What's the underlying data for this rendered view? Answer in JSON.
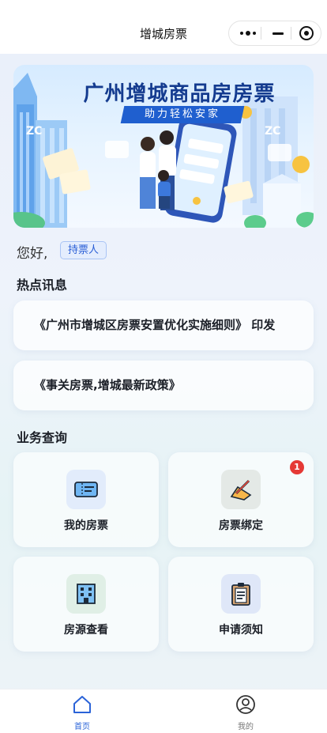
{
  "nav": {
    "title": "增城房票",
    "more_icon": "more-dots-icon",
    "minimize_icon": "minimize-icon",
    "close_icon": "target-close-icon"
  },
  "banner": {
    "title": "广州增城商品房房票",
    "subtitle": "助力轻松安家",
    "building_label": "ZC"
  },
  "greeting": {
    "text": "您好,",
    "role_badge": "持票人"
  },
  "hot_news": {
    "title": "热点讯息",
    "items": [
      "《广州市增城区房票安置优化实施细则》 印发",
      "《事关房票,增城最新政策》"
    ]
  },
  "services": {
    "title": "业务查询",
    "items": [
      {
        "label": "我的房票",
        "icon": "ticket-icon",
        "badge": ""
      },
      {
        "label": "房票绑定",
        "icon": "pen-sign-icon",
        "badge": "1"
      },
      {
        "label": "房源查看",
        "icon": "building-icon",
        "badge": ""
      },
      {
        "label": "申请须知",
        "icon": "clipboard-icon",
        "badge": ""
      }
    ]
  },
  "tabbar": {
    "items": [
      {
        "label": "首页",
        "icon": "home-icon",
        "active": true
      },
      {
        "label": "我的",
        "icon": "user-icon",
        "active": false
      }
    ]
  },
  "colors": {
    "accent": "#2a63d8",
    "badge_red": "#e53935",
    "banner_title": "#143b8f"
  }
}
